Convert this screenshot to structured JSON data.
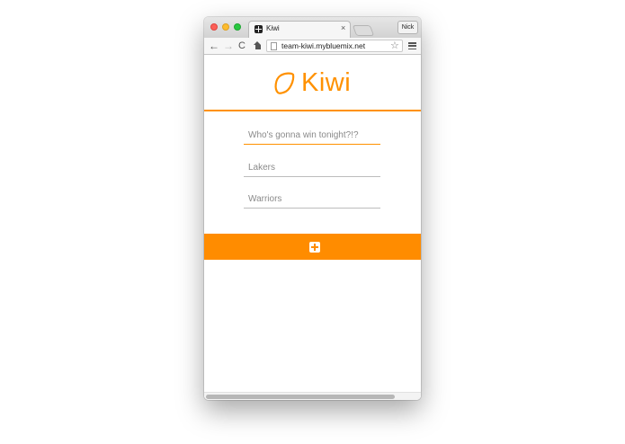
{
  "browser": {
    "tab_title": "Kiwi",
    "tab_close": "×",
    "profile_name": "Nick",
    "url": "team-kiwi.mybluemix.net",
    "nav": {
      "back": "←",
      "forward": "→",
      "reload": "C"
    }
  },
  "app": {
    "logo_text": "Kiwi",
    "accent_color": "#ff9100",
    "question_placeholder": "Who's gonna win tonight?!?",
    "option1_placeholder": "Lakers",
    "option2_placeholder": "Warriors",
    "add_icon": "plus-square-icon"
  }
}
